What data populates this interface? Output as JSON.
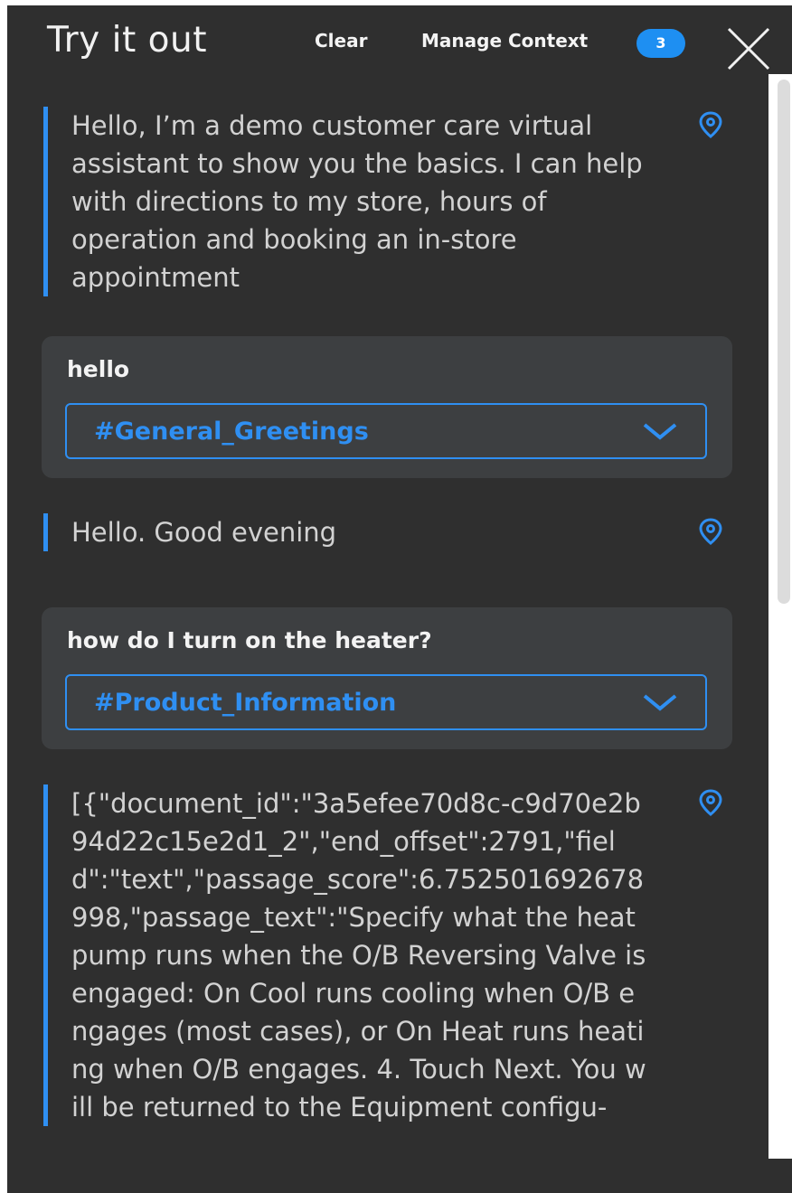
{
  "header": {
    "title": "Try it out",
    "clear_label": "Clear",
    "manage_label": "Manage Context",
    "context_count": "3"
  },
  "messages": [
    {
      "type": "bot",
      "text": "Hello, I’m a demo customer care virtual assistant to show you the basics. I can help with directions to my store, hours of operation and booking an in-store appointment",
      "icon": "location-pin-icon"
    },
    {
      "type": "user",
      "utterance": "hello",
      "intent": "#General_Greetings"
    },
    {
      "type": "bot",
      "text": "Hello. Good evening",
      "icon": "location-pin-icon"
    },
    {
      "type": "user",
      "utterance": "how do I turn on the heater?",
      "intent": "#Product_Information"
    },
    {
      "type": "bot",
      "text": "[{\"document_id\":\"3a5efee70d8c-c9d70e2b94d22c15e2d1_2\",\"end_offset\":2791,\"field\":\"text\",\"passage_score\":6.752501692678998,\"passage_text\":\"Specify what the heat pump runs when the O/B Reversing Valve is engaged: On Cool runs cooling when O/B engages (most cases), or On Heat runs heating when O/B engages. 4. Touch Next. You will be returned to the Equipment configu-",
      "icon": "location-pin-icon"
    }
  ],
  "colors": {
    "accent": "#2f8ff2",
    "panel": "#2f2f2f",
    "card": "#3d3f41"
  }
}
